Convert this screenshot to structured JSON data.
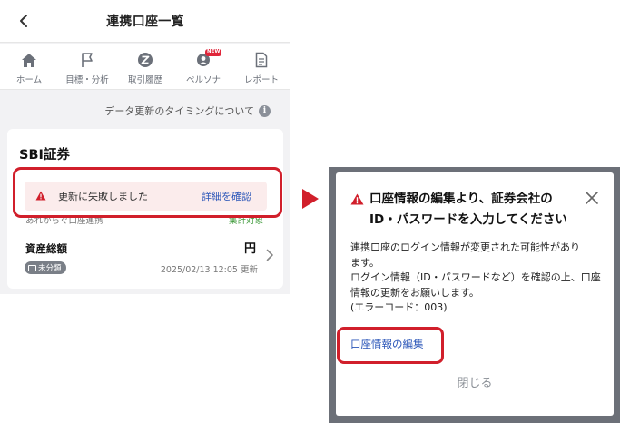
{
  "header": {
    "title": "連携口座一覧"
  },
  "tabs": [
    {
      "label": "ホーム",
      "icon": "home-icon"
    },
    {
      "label": "目標・分析",
      "icon": "flag-icon"
    },
    {
      "label": "取引履歴",
      "icon": "zaim-logo-icon"
    },
    {
      "label": "ペルソナ",
      "icon": "persona-icon",
      "badge": "NEW"
    },
    {
      "label": "レポート",
      "icon": "document-icon"
    }
  ],
  "timing_link": "データ更新のタイミングについて",
  "card": {
    "title": "SBI証券",
    "error": {
      "message": "更新に失敗しました",
      "link": "詳細を確認"
    },
    "account_name": "あれからぐ口座連携",
    "aggregate_label": "集計対象",
    "asset_label": "資産総額",
    "asset_unit": "円",
    "tag": "未分類",
    "updated": "2025/02/13 12:05 更新"
  },
  "dialog": {
    "title": "口座情報の編集より、証券会社のID・パスワードを入力してください",
    "body_lines": [
      "連携口座のログイン情報が変更された可能性があり",
      "ます。",
      "ログイン情報（ID・パスワードなど）を確認の上、口座",
      "情報の更新をお願いします。",
      "(エラーコード：003)"
    ],
    "edit_link": "口座情報の編集",
    "close_label": "閉じる"
  },
  "colors": {
    "accent_red": "#d11f2b",
    "link_blue": "#2a55b8",
    "error_bg": "#fbecec",
    "aggregate_green": "#3f9a3b"
  }
}
